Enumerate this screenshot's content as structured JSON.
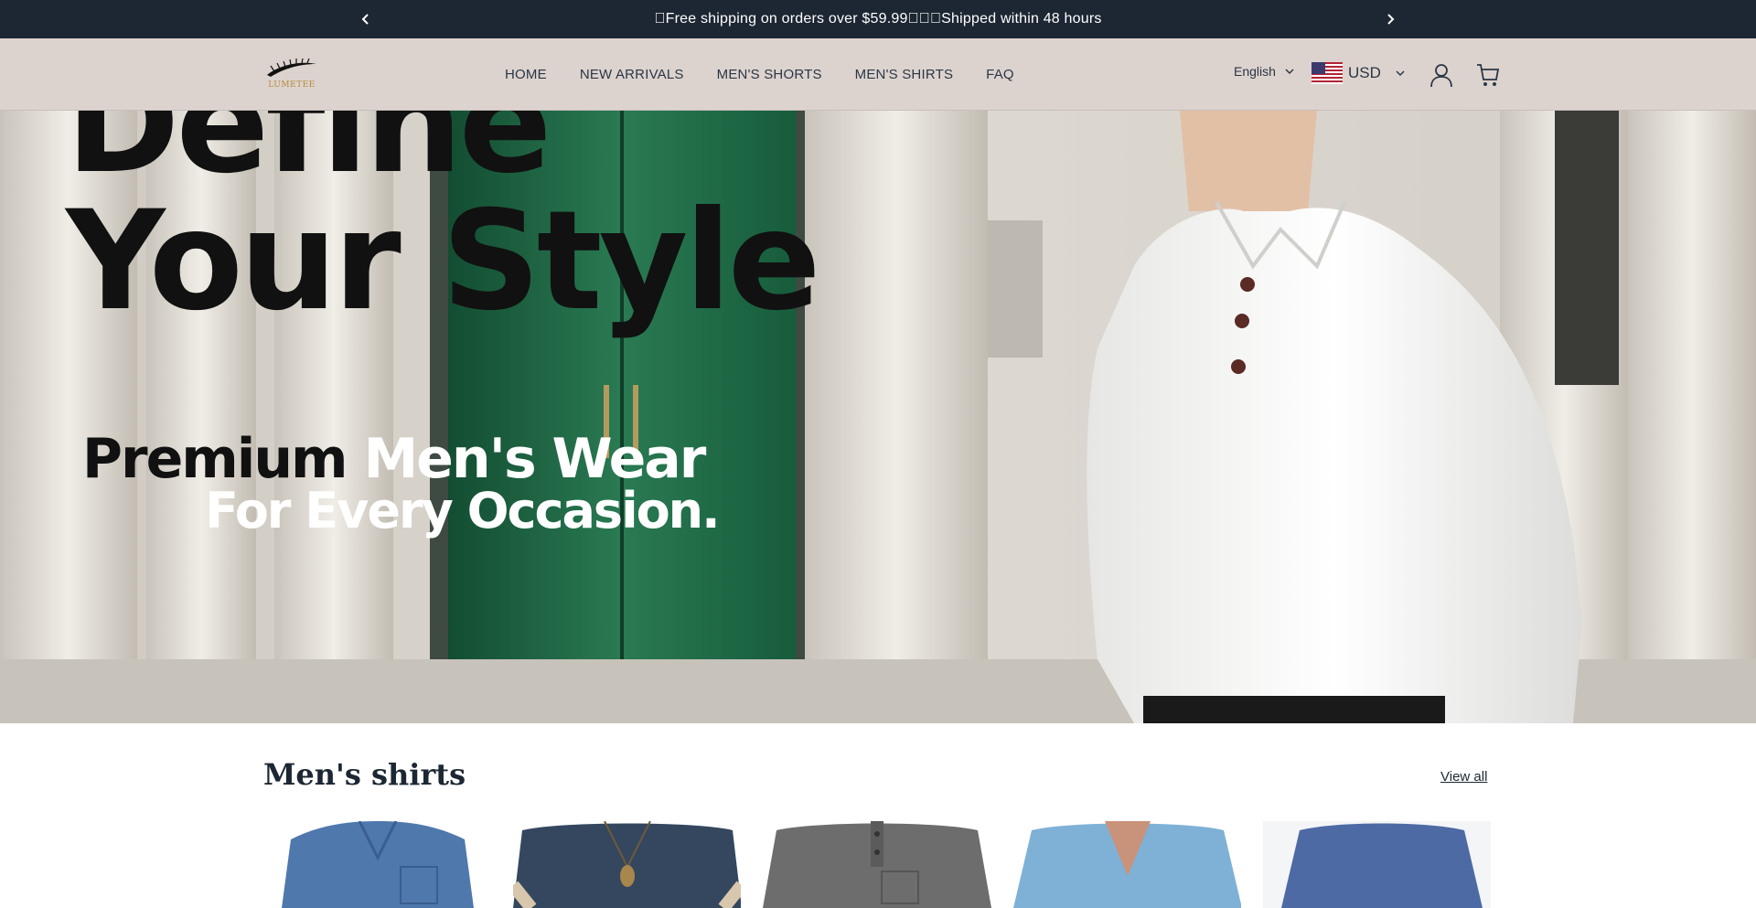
{
  "announcement": {
    "text": "\u0000Free shipping on orders over $59.99\u0000\u0000\u0000Shipped within 48 hours",
    "prev_icon": "chevron-left-icon",
    "next_icon": "chevron-right-icon"
  },
  "header": {
    "logo_text": "LUMETEE",
    "nav": [
      "HOME",
      "NEW ARRIVALS",
      "MEN'S SHORTS",
      "MEN'S SHIRTS",
      "FAQ"
    ],
    "language": "English",
    "currency": "USD",
    "icons": [
      "account-icon",
      "cart-icon",
      "us-flag-icon",
      "chevron-down-icon"
    ]
  },
  "hero": {
    "headline_line1": "Define",
    "headline_line2": "Your Style",
    "sub_dark": "Premium",
    "sub_light": "Men's Wear",
    "sub_line2": "For Every Occasion."
  },
  "collection": {
    "title": "Men's shirts",
    "view_all": "View all",
    "product_colors": [
      "#4f78ad",
      "#34475f",
      "#6d6d6d",
      "#7fb1d6",
      "#4d6aa4"
    ]
  },
  "colors": {
    "announcement_bg": "#1d2733",
    "header_bg": "#dcd3cf",
    "door_green": "#1f6a47"
  }
}
